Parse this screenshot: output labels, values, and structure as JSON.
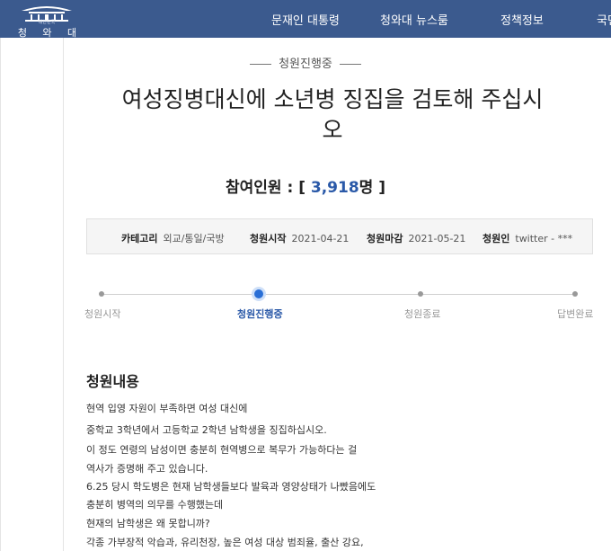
{
  "header": {
    "logo_sub": "대한민국",
    "logo_text": "청 와 대",
    "nav": [
      "문재인 대통령",
      "청와대 뉴스룸",
      "정책정보",
      "국민"
    ]
  },
  "petition": {
    "status": "청원진행중",
    "title_line1": "여성징병대신에 소년병 징집을 검토해 주십시",
    "title_line2": "오",
    "participants_label": "참여인원 :",
    "participants_open": "[",
    "participants_count": "3,918",
    "participants_unit": "명",
    "participants_close": "]"
  },
  "info": {
    "category_label": "카테고리",
    "category_value": "외교/통일/국방",
    "start_label": "청원시작",
    "start_value": "2021-04-21",
    "end_label": "청원마감",
    "end_value": "2021-05-21",
    "author_label": "청원인",
    "author_value": "twitter - ***"
  },
  "steps": [
    "청원시작",
    "청원진행중",
    "청원종료",
    "답변완료"
  ],
  "content": {
    "heading": "청원내용",
    "lines": [
      "현역 입영 자원이 부족하면 여성 대신에",
      "중학교 3학년에서 고등학교 2학년 남학생을 징집하십시오.",
      "이 정도 연령의 남성이면 충분히 현역병으로 복무가 가능하다는 걸",
      "역사가 증명해 주고 있습니다.",
      "6.25 당시 학도병은 현재 남학생들보다 발육과 영양상태가 나빴음에도",
      "충분히 병역의 의무를 수행했는데",
      "현재의 남학생은 왜 못합니까?",
      "각종 가부장적 악습과, 유리천장, 높은 여성 대상 범죄율, 출산 강요,"
    ]
  }
}
